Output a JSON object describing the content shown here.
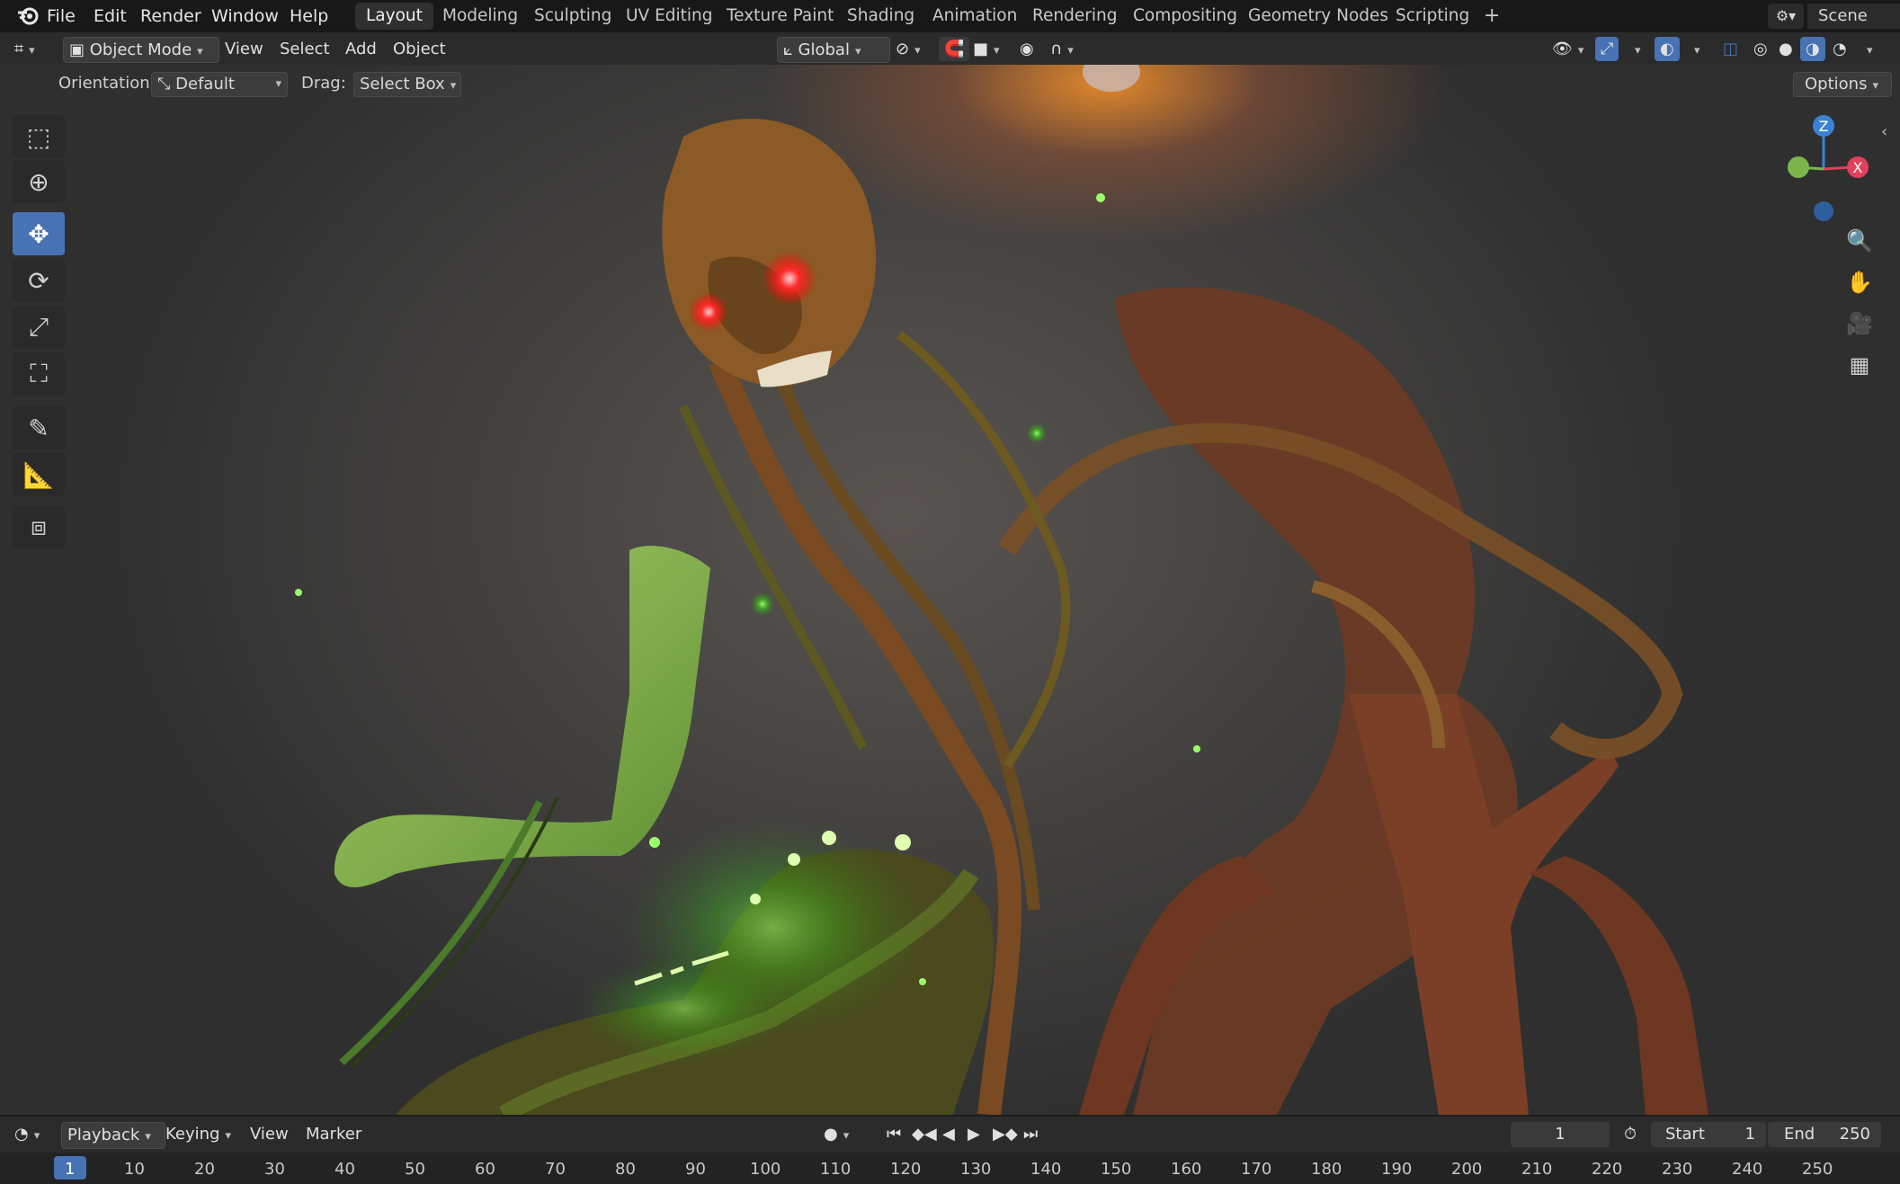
{
  "menu": [
    "File",
    "Edit",
    "Render",
    "Window",
    "Help"
  ],
  "workspaces": [
    "Layout",
    "Modeling",
    "Sculpting",
    "UV Editing",
    "Texture Paint",
    "Shading",
    "Animation",
    "Rendering",
    "Compositing",
    "Geometry Nodes",
    "Scripting"
  ],
  "scene_name": "Scene",
  "header": {
    "mode": "Object Mode",
    "view": "View",
    "select": "Select",
    "add": "Add",
    "object": "Object",
    "transform_orientation": "Global"
  },
  "tool_settings": {
    "orientation_label": "Orientation:",
    "orientation_value": "Default",
    "drag_label": "Drag:",
    "drag_value": "Select Box",
    "options": "Options"
  },
  "gizmo_axes": {
    "z": "Z",
    "x": "X"
  },
  "timeline": {
    "playback": "Playback",
    "keying": "Keying",
    "view": "View",
    "marker": "Marker",
    "current_frame": "1",
    "start_label": "Start",
    "start_value": "1",
    "end_label": "End",
    "end_value": "250",
    "ticks": [
      "1",
      "10",
      "20",
      "30",
      "40",
      "50",
      "60",
      "70",
      "80",
      "90",
      "100",
      "110",
      "120",
      "130",
      "140",
      "150",
      "160",
      "170",
      "180",
      "190",
      "200",
      "210",
      "220",
      "230",
      "240",
      "250"
    ]
  },
  "colors": {
    "accent": "#4772b3",
    "x_axis": "#e0405a",
    "y_axis": "#7ab64b",
    "z_axis": "#3b82d6"
  }
}
